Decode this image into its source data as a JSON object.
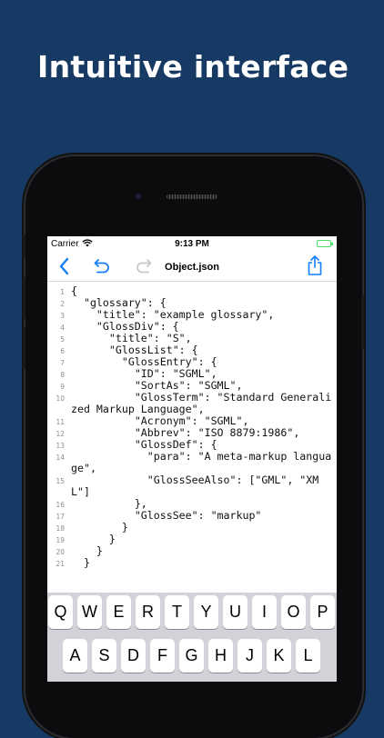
{
  "headline": "Intuitive interface",
  "status_bar": {
    "carrier": "Carrier",
    "time": "9:13 PM",
    "battery_color": "#4cd964"
  },
  "nav": {
    "title": "Object.json",
    "back_icon": "chevron-left-icon",
    "undo_icon": "undo-icon",
    "redo_icon": "redo-icon",
    "share_icon": "share-icon",
    "accent_color": "#147efb"
  },
  "editor": {
    "lines": [
      {
        "n": "1",
        "text": "{"
      },
      {
        "n": "2",
        "text": "  \"glossary\": {"
      },
      {
        "n": "3",
        "text": "    \"title\": \"example glossary\","
      },
      {
        "n": "4",
        "text": "    \"GlossDiv\": {"
      },
      {
        "n": "5",
        "text": "      \"title\": \"S\","
      },
      {
        "n": "6",
        "text": "      \"GlossList\": {"
      },
      {
        "n": "7",
        "text": "        \"GlossEntry\": {"
      },
      {
        "n": "8",
        "text": "          \"ID\": \"SGML\","
      },
      {
        "n": "9",
        "text": "          \"SortAs\": \"SGML\","
      },
      {
        "n": "10",
        "text": "          \"GlossTerm\": \"Standard Generalized Markup Language\","
      },
      {
        "n": "11",
        "text": "          \"Acronym\": \"SGML\","
      },
      {
        "n": "12",
        "text": "          \"Abbrev\": \"ISO 8879:1986\","
      },
      {
        "n": "13",
        "text": "          \"GlossDef\": {"
      },
      {
        "n": "14",
        "text": "            \"para\": \"A meta-markup language\","
      },
      {
        "n": "15",
        "text": "            \"GlossSeeAlso\": [\"GML\", \"XML\"]"
      },
      {
        "n": "16",
        "text": "          },"
      },
      {
        "n": "17",
        "text": "          \"GlossSee\": \"markup\""
      },
      {
        "n": "18",
        "text": "        }"
      },
      {
        "n": "19",
        "text": "      }"
      },
      {
        "n": "20",
        "text": "    }"
      },
      {
        "n": "21",
        "text": "  }"
      }
    ]
  },
  "keyboard": {
    "row1": [
      "Q",
      "W",
      "E",
      "R",
      "T",
      "Y",
      "U",
      "I",
      "O",
      "P"
    ],
    "row2": [
      "A",
      "S",
      "D",
      "F",
      "G",
      "H",
      "J",
      "K",
      "L"
    ]
  }
}
